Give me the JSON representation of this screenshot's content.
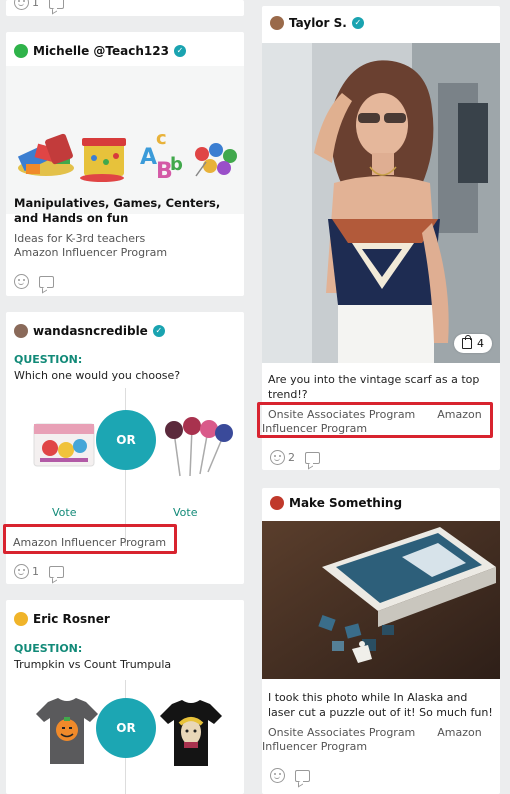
{
  "top_left_card": {
    "reactions": {
      "likes": "1"
    }
  },
  "card_michelle": {
    "author": "Michelle @Teach123",
    "title": "Manipulatives, Games, Centers, and Hands on fun",
    "subtitle": "Ideas for K-3rd teachers",
    "program": "Amazon Influencer Program",
    "colors": {
      "avatar": "#2fb34a"
    }
  },
  "card_wanda": {
    "author": "wandasncredible",
    "question_label": "QUESTION:",
    "question": "Which one would you choose?",
    "or_label": "OR",
    "vote_left": "Vote",
    "vote_right": "Vote",
    "program": "Amazon Influencer Program",
    "reactions": {
      "likes": "1"
    }
  },
  "card_eric": {
    "author": "Eric Rosner",
    "question_label": "QUESTION:",
    "question": "Trumpkin vs Count Trumpula",
    "or_label": "OR"
  },
  "card_taylor": {
    "author": "Taylor S.",
    "product_count": "4",
    "caption": "Are you into the vintage scarf as a top trend!?",
    "program_1": "Onsite Associates Program",
    "program_2": "Amazon Influencer Program",
    "reactions": {
      "likes": "2"
    }
  },
  "card_make": {
    "author": "Make Something",
    "caption": "I took this photo while In Alaska and laser cut a puzzle out of it! So much fun!",
    "program_1": "Onsite Associates Program",
    "program_2": "Amazon Influencer Program"
  },
  "highlight_color": "#d8232f",
  "accent_color": "#1ca6b3"
}
